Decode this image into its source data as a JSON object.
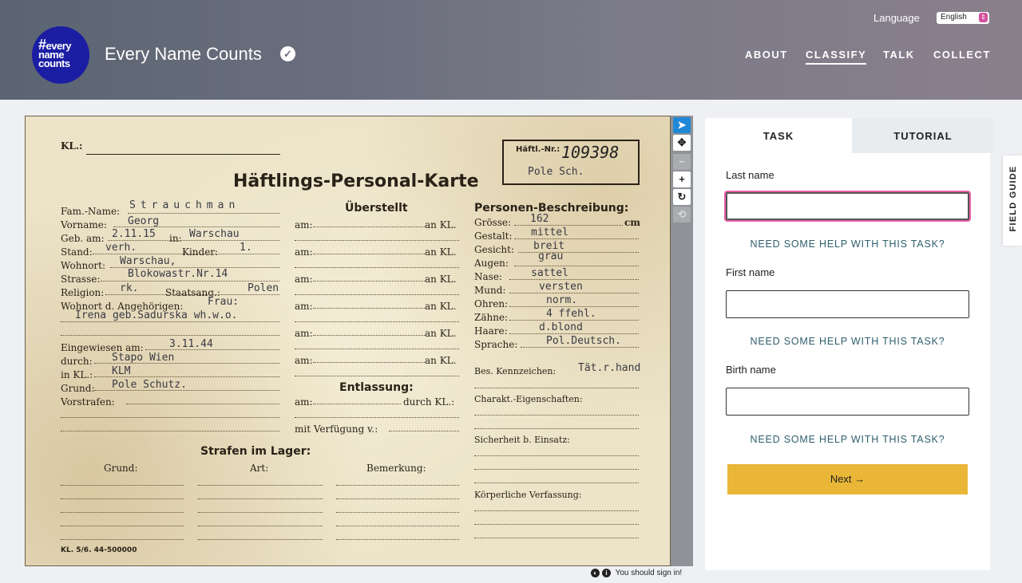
{
  "header": {
    "logo_hash": "#",
    "logo_line1": "every",
    "logo_line2": "name",
    "logo_line3": "counts",
    "site_title": "Every Name Counts",
    "language_label": "Language",
    "language_value": "English",
    "nav": [
      "ABOUT",
      "CLASSIFY",
      "TALK",
      "COLLECT"
    ],
    "active_nav": "CLASSIFY"
  },
  "subject": {
    "kl": "KL.:",
    "haeftl_nr_label": "Häftl.-Nr.:",
    "haeftl_nr": "109398",
    "haeftl_cat": "Pole Sch.",
    "title": "Häftlings-Personal-Karte",
    "fam_name_label": "Fam.-Name:",
    "fam_name": "Strauchman",
    "vorname_label": "Vorname:",
    "vorname": "Georg",
    "geb_label": "Geb. am:",
    "geb": "2.11.15",
    "in_label": "in:",
    "geb_ort": "Warschau",
    "stand_label": "Stand:",
    "stand": "verh.",
    "kinder_label": "Kinder:",
    "kinder": "1.",
    "wohnort_label": "Wohnort:",
    "wohnort": "Warschau,",
    "strasse_label": "Strasse:",
    "strasse": "Blokowastr.Nr.14",
    "religion_label": "Religion:",
    "religion": "rk.",
    "staatsang_label": "Staatsang.:",
    "staatsang": "Polen",
    "angehoerige_label": "Wohnort d. Angehörigen:",
    "angehoerige1": "Frau:",
    "angehoerige2": "Irena geb.Sadurska wh.w.o.",
    "eingewiesen_label": "Eingewiesen am:",
    "eingewiesen": "3.11.44",
    "durch_label": "durch:",
    "durch": "Stapo Wien",
    "inkl_label": "in KL.:",
    "inkl": "KLM",
    "grund_label": "Grund:",
    "grund": "Pole Schutz.",
    "vorstrafen_label": "Vorstrafen:",
    "ueberstellt": "Überstellt",
    "am_label": "am:",
    "ankl_label": "an KL.",
    "entlassung": "Entlassung:",
    "durch_kl_label": "durch KL.:",
    "verfuegung_label": "mit Verfügung v.:",
    "beschreibung": "Personen-Beschreibung:",
    "groesse_label": "Grösse:",
    "groesse": "162",
    "cm": "cm",
    "gestalt_label": "Gestalt:",
    "gestalt": "mittel",
    "gesicht_label": "Gesicht:",
    "gesicht": "breit",
    "augen_label": "Augen:",
    "augen": "grau",
    "nase_label": "Nase:",
    "nase": "sattel",
    "mund_label": "Mund:",
    "mund": "versten",
    "ohren_label": "Ohren:",
    "ohren": "norm.",
    "zaehne_label": "Zähne:",
    "zaehne": "4 ffehl.",
    "haare_label": "Haare:",
    "haare": "d.blond",
    "sprache_label": "Sprache:",
    "sprache": "Pol.Deutsch.",
    "kennzeichen_label": "Bes. Kennzeichen:",
    "kennzeichen": "Tät.r.hand",
    "charakt_label": "Charakt.-Eigenschaften:",
    "sicherheit_label": "Sicherheit b. Einsatz:",
    "koerper_label": "Körperliche Verfassung:",
    "strafen": "Strafen im Lager:",
    "col_grund": "Grund:",
    "col_art": "Art:",
    "col_bemerkung": "Bemerkung:",
    "footer": "KL. 5/6. 44-500000"
  },
  "signin_text": "You should sign in!",
  "task": {
    "tabs": [
      "TASK",
      "TUTORIAL"
    ],
    "questions": [
      {
        "label": "Last name",
        "value": ""
      },
      {
        "label": "First name",
        "value": ""
      },
      {
        "label": "Birth name",
        "value": ""
      }
    ],
    "help_label": "NEED SOME HELP WITH THIS TASK?",
    "next_label": "Next",
    "next_icon": "→",
    "field_guide": "FIELD GUIDE"
  },
  "colors": {
    "logo": "#1b1ea3",
    "next_button": "#e9b638",
    "focus_ring": "#e85fa7",
    "help_text": "#2f5f6e",
    "active_tool": "#1f88d6"
  }
}
